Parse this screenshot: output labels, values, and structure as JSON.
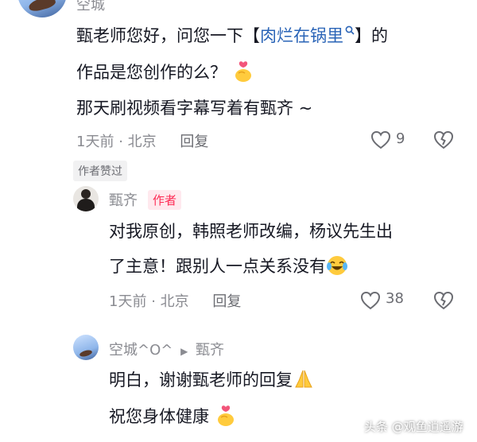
{
  "comment1": {
    "username": "空城",
    "text_a": "甄老师您好，问您一下【",
    "link": "肉烂在锅里",
    "text_b": "】的",
    "line2": "作品是您创作的么？",
    "line3": "那天刷视频看字幕写着有甄齐 ~",
    "time": "1天前",
    "location": "北京",
    "reply_label": "回复",
    "like_count": "9",
    "author_liked_badge": "作者赞过"
  },
  "reply1": {
    "username": "甄齐",
    "author_tag": "作者",
    "line1": "对我原创，韩照老师改编，杨议先生出",
    "line2": "了主意！跟别人一点关系没有",
    "time": "1天前",
    "location": "北京",
    "reply_label": "回复",
    "like_count": "38"
  },
  "reply2": {
    "username": "空城^O^",
    "reply_to": "甄齐",
    "line1": "明白，谢谢甄老师的回复",
    "line2": "祝您身体健康"
  },
  "watermark": "头条 @观鱼逍遥游",
  "colors": {
    "link": "#2a64b7",
    "meta": "#8a8b91",
    "author_tag": "#fe2c55",
    "text": "#161823"
  }
}
